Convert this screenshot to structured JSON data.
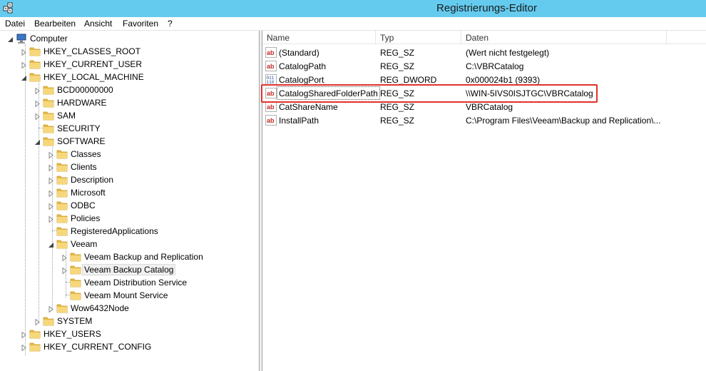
{
  "window": {
    "title": "Registrierungs-Editor"
  },
  "menu": [
    "Datei",
    "Bearbeiten",
    "Ansicht",
    "Favoriten",
    "?"
  ],
  "tree": {
    "root": "Computer",
    "hkcr": "HKEY_CLASSES_ROOT",
    "hkcu": "HKEY_CURRENT_USER",
    "hklm": "HKEY_LOCAL_MACHINE",
    "bcd": "BCD00000000",
    "hardware": "HARDWARE",
    "sam": "SAM",
    "security": "SECURITY",
    "software": "SOFTWARE",
    "classes": "Classes",
    "clients": "Clients",
    "description": "Description",
    "microsoft": "Microsoft",
    "odbc": "ODBC",
    "policies": "Policies",
    "regapps": "RegisteredApplications",
    "veeam": "Veeam",
    "veeam_br": "Veeam Backup and Replication",
    "veeam_catalog": "Veeam Backup Catalog",
    "veeam_dist": "Veeam Distribution Service",
    "veeam_mount": "Veeam Mount Service",
    "wow": "Wow6432Node",
    "system": "SYSTEM",
    "hku": "HKEY_USERS",
    "hkcc": "HKEY_CURRENT_CONFIG"
  },
  "list": {
    "headers": {
      "name": "Name",
      "type": "Typ",
      "data": "Daten"
    },
    "rows": [
      {
        "name": "(Standard)",
        "type": "REG_SZ",
        "data": "(Wert nicht festgelegt)",
        "icon": "string-value-icon"
      },
      {
        "name": "CatalogPath",
        "type": "REG_SZ",
        "data": "C:\\VBRCatalog",
        "icon": "string-value-icon"
      },
      {
        "name": "CatalogPort",
        "type": "REG_DWORD",
        "data": "0x000024b1 (9393)",
        "icon": "dword-value-icon"
      },
      {
        "name": "CatalogSharedFolderPath",
        "type": "REG_SZ",
        "data": "\\\\WIN-5IVS0ISJTGC\\VBRCatalog",
        "icon": "string-value-icon"
      },
      {
        "name": "CatShareName",
        "type": "REG_SZ",
        "data": "VBRCatalog",
        "icon": "string-value-icon"
      },
      {
        "name": "InstallPath",
        "type": "REG_SZ",
        "data": "C:\\Program Files\\Veeam\\Backup and Replication\\...",
        "icon": "string-value-icon"
      }
    ]
  },
  "colors": {
    "titlebar": "#64cbef",
    "highlight": "#e0322b",
    "folder": "#e8b944"
  }
}
